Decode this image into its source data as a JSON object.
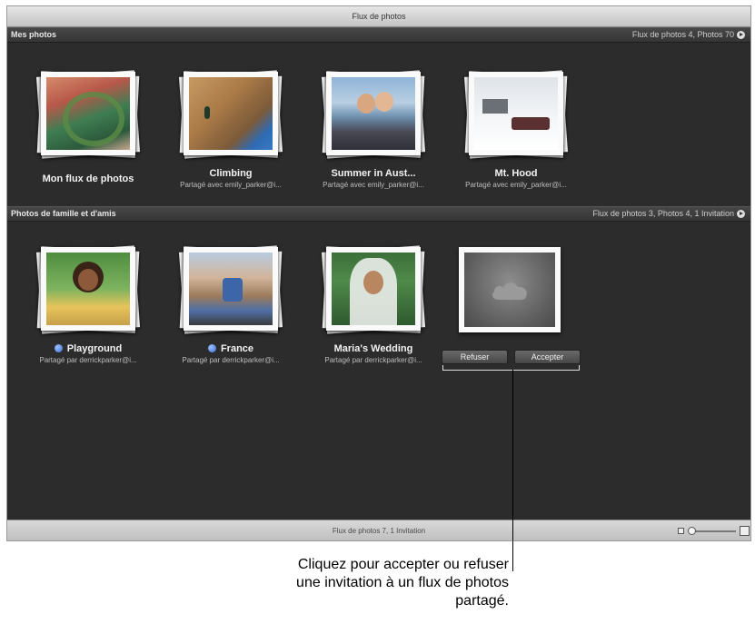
{
  "window": {
    "title": "Flux de photos"
  },
  "my_photos": {
    "header": "Mes photos",
    "info": "Flux de photos 4, Photos 70",
    "albums": [
      {
        "name": "Mon flux de photos",
        "sub": ""
      },
      {
        "name": "Climbing",
        "sub": "Partagé avec emily_parker@i..."
      },
      {
        "name": "Summer in Aust...",
        "sub": "Partagé avec emily_parker@i..."
      },
      {
        "name": "Mt. Hood",
        "sub": "Partagé avec emily_parker@i..."
      }
    ]
  },
  "family": {
    "header": "Photos de famille et d'amis",
    "info": "Flux de photos 3, Photos 4, 1 Invitation",
    "albums": [
      {
        "name": "Playground",
        "sub": "Partagé par derrickparker@i...",
        "unread": true
      },
      {
        "name": "France",
        "sub": "Partagé par derrickparker@i...",
        "unread": true
      },
      {
        "name": "Maria's Wedding",
        "sub": "Partagé par derrickparker@i...",
        "unread": false
      }
    ],
    "invitation": {
      "decline_label": "Refuser",
      "accept_label": "Accepter"
    }
  },
  "status": {
    "text": "Flux de photos 7, 1 Invitation"
  },
  "callout": {
    "line1": "Cliquez pour accepter ou refuser",
    "line2": "une invitation à un flux de photos",
    "line3": "partagé."
  }
}
